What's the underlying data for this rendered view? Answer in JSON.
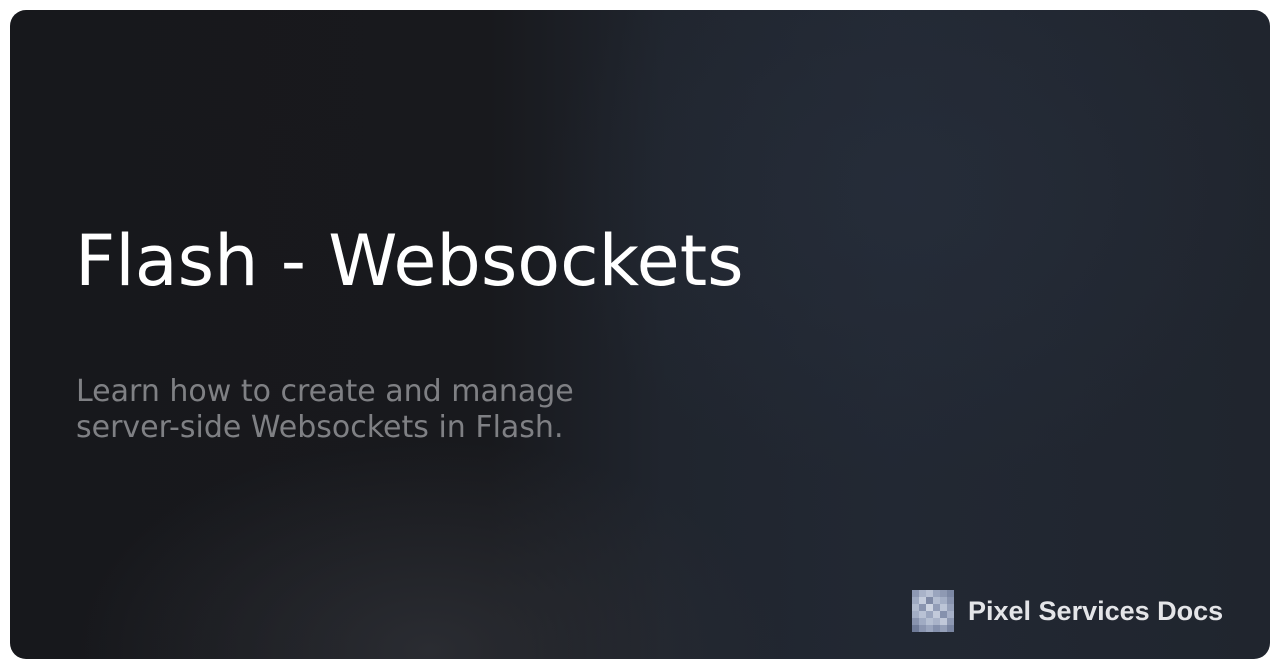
{
  "page": {
    "title": "Flash - Websockets",
    "description": "Learn how to create and manage server-side Websockets in Flash."
  },
  "brand": {
    "name": "Pixel Services Docs",
    "logo_icon": "pixelated-logo-icon"
  },
  "colors": {
    "background_dark": "#17181c",
    "background_blue": "#222833",
    "title": "#ffffff",
    "description": "#7f8084",
    "brand_text": "#e4e5e8"
  }
}
